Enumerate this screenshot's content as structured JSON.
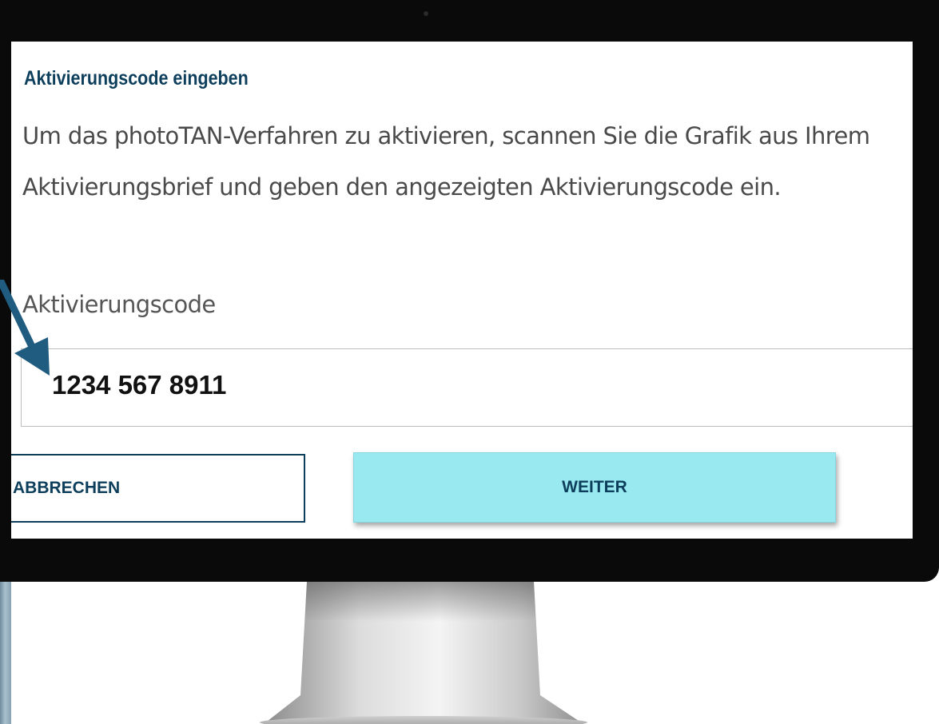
{
  "dialog": {
    "title": "Aktivierungscode eingeben",
    "body": "Um das photoTAN-Verfahren zu aktivieren, scannen Sie die Grafik aus Ihrem Aktivierungsbrief und geben den angezeigten Aktivierungscode ein.",
    "field_label": "Aktivierungscode",
    "code_value": "1234 567 8911",
    "cancel_label": "ABBRECHEN",
    "next_label": "WEITER"
  },
  "colors": {
    "accent": "#0d3f5c",
    "primary_button": "#98e9f0",
    "arrow": "#1f5c80"
  },
  "icons": {
    "pointer": "arrow-down-right-icon"
  }
}
